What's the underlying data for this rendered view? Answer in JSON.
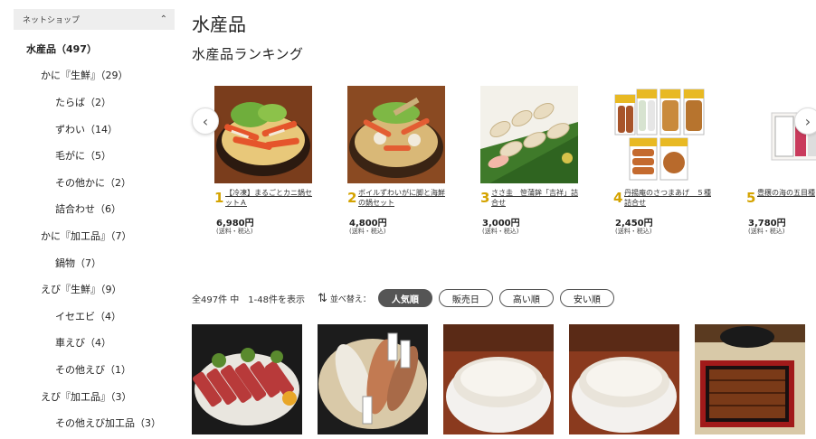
{
  "sidebar": {
    "header_label": "ネットショップ",
    "items": [
      {
        "label": "水産品（497）",
        "level": 0
      },
      {
        "label": "かに『生鮮』（29）",
        "level": 1
      },
      {
        "label": "たらば（2）",
        "level": 2
      },
      {
        "label": "ずわい（14）",
        "level": 2
      },
      {
        "label": "毛がに（5）",
        "level": 2
      },
      {
        "label": "その他かに（2）",
        "level": 2
      },
      {
        "label": "詰合わせ（6）",
        "level": 2
      },
      {
        "label": "かに『加工品』（7）",
        "level": 1
      },
      {
        "label": "鍋物（7）",
        "level": 2
      },
      {
        "label": "えび『生鮮』（9）",
        "level": 1
      },
      {
        "label": "イセエビ（4）",
        "level": 2
      },
      {
        "label": "車えび（4）",
        "level": 2
      },
      {
        "label": "その他えび（1）",
        "level": 2
      },
      {
        "label": "えび『加工品』（3）",
        "level": 1
      },
      {
        "label": "その他えび加工品（3）",
        "level": 2
      }
    ]
  },
  "main": {
    "title": "水産品",
    "ranking_title": "水産品ランキング",
    "ranking": [
      {
        "rank": "1",
        "name": "【冷凍】まるごとカニ鍋セットＡ",
        "price": "6,980円",
        "tax": "(送料・税込)"
      },
      {
        "rank": "2",
        "name": "ボイルずわいがに脚と海鮮の鍋セット",
        "price": "4,800円",
        "tax": "(送料・税込)"
      },
      {
        "rank": "3",
        "name": "ささ圭　笹蒲鉾「吉祥」詰合せ",
        "price": "3,000円",
        "tax": "(送料・税込)"
      },
      {
        "rank": "4",
        "name": "丹揚庵のさつまあげ　５種詰合せ",
        "price": "2,450円",
        "tax": "(送料・税込)"
      },
      {
        "rank": "5",
        "name": "豊穣の海の五目種",
        "price": "3,780円",
        "tax": "(送料・税込)"
      }
    ],
    "count_text": "全497件 中　1-48件を表示",
    "sort_label": "並べ替え：",
    "sort_options": [
      "人気順",
      "販売日",
      "高い順",
      "安い順"
    ],
    "sort_active": "人気順"
  },
  "colors": {
    "rank_number": "#d4a300",
    "sort_active_bg": "#555555",
    "sidebar_header_bg": "#eeeeee"
  }
}
